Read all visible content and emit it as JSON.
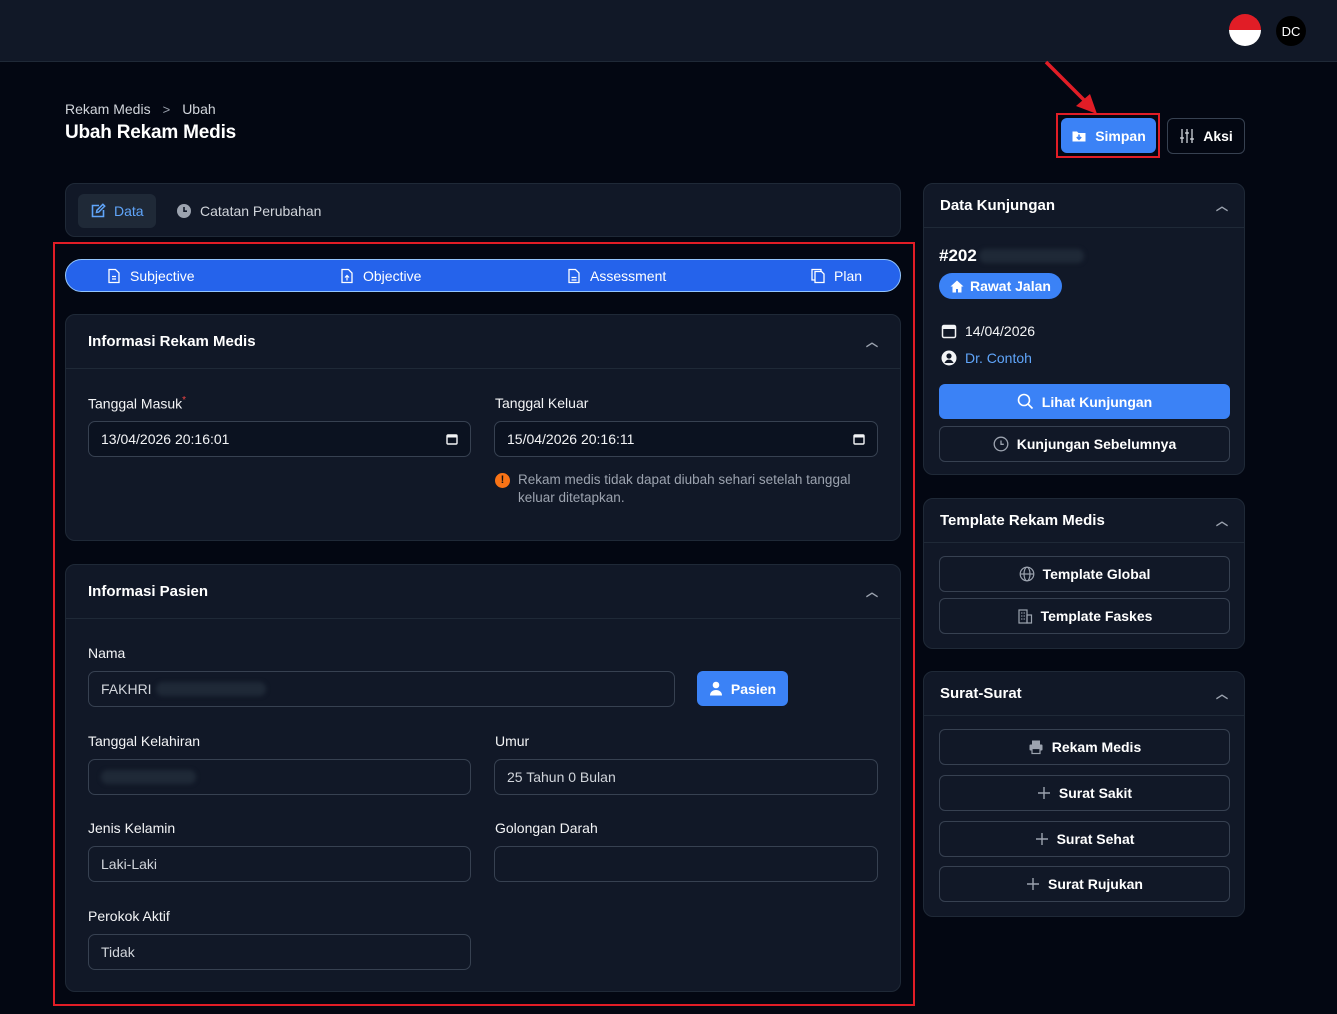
{
  "header": {
    "flag_icon": "indonesia-flag",
    "avatar_initials": "DC"
  },
  "breadcrumb": {
    "items": [
      "Rekam Medis",
      "Ubah"
    ],
    "separator": ">"
  },
  "page": {
    "title": "Ubah Rekam Medis"
  },
  "actions": {
    "save_label": "Simpan",
    "actions_label": "Aksi"
  },
  "tabs": [
    {
      "label": "Data",
      "icon": "edit-icon",
      "active": true
    },
    {
      "label": "Catatan Perubahan",
      "icon": "clock-icon",
      "active": false
    }
  ],
  "soap": [
    "Subjective",
    "Objective",
    "Assessment",
    "Plan"
  ],
  "record_info": {
    "title": "Informasi Rekam Medis",
    "admit_label": "Tanggal Masuk",
    "admit_value": "13/04/2026 20:16:01",
    "discharge_label": "Tanggal Keluar",
    "discharge_value": "15/04/2026 20:16:11",
    "note": "Rekam medis tidak dapat diubah sehari setelah tanggal keluar ditetapkan."
  },
  "patient_info": {
    "title": "Informasi Pasien",
    "name_label": "Nama",
    "name_value": "FAKHRI",
    "patient_button": "Pasien",
    "dob_label": "Tanggal Kelahiran",
    "age_label": "Umur",
    "age_value": "25 Tahun 0 Bulan",
    "gender_label": "Jenis Kelamin",
    "gender_value": "Laki-Laki",
    "blood_label": "Golongan Darah",
    "blood_value": "",
    "smoker_label": "Perokok Aktif",
    "smoker_value": "Tidak"
  },
  "visit": {
    "title": "Data Kunjungan",
    "id_prefix": "#202",
    "type": "Rawat Jalan",
    "date": "14/04/2026",
    "doctor": "Dr. Contoh",
    "view_button": "Lihat Kunjungan",
    "previous_button": "Kunjungan Sebelumnya"
  },
  "templates": {
    "title": "Template Rekam Medis",
    "global_button": "Template Global",
    "facility_button": "Template Faskes"
  },
  "letters": {
    "title": "Surat-Surat",
    "items": [
      "Rekam Medis",
      "Surat Sakit",
      "Surat Sehat",
      "Surat Rujukan"
    ]
  },
  "colors": {
    "accent": "#3b82f6",
    "highlight": "#e11d26",
    "background": "#030712",
    "card": "#111827"
  }
}
